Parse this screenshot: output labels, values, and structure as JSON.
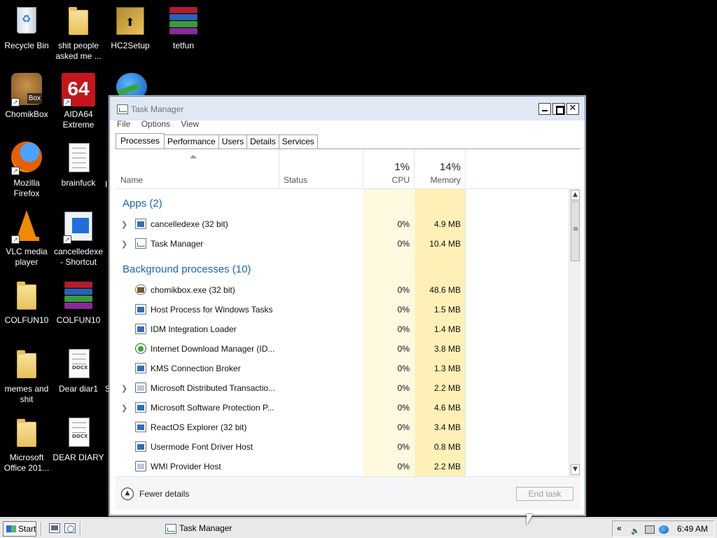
{
  "desktop": {
    "icons": [
      {
        "label": "Recycle Bin",
        "icon": "recycle-bin-icon"
      },
      {
        "label": "shit people asked me ...",
        "icon": "folder-icon"
      },
      {
        "label": "HC2Setup",
        "icon": "installer-icon"
      },
      {
        "label": "tetfun",
        "icon": "winrar-icon"
      },
      {
        "label": "ChomikBox",
        "icon": "chomikbox-icon"
      },
      {
        "label": "AIDA64 Extreme",
        "icon": "aida64-icon"
      },
      {
        "label": "Mozilla Firefox",
        "icon": "firefox-icon"
      },
      {
        "label": "brainfuck",
        "icon": "text-document-icon"
      },
      {
        "label": "VLC media player",
        "icon": "vlc-icon"
      },
      {
        "label": "cancelledexe - Shortcut",
        "icon": "shortcut-icon"
      },
      {
        "label": "COLFUN10",
        "icon": "folder-icon"
      },
      {
        "label": "COLFUN10",
        "icon": "winrar-icon"
      },
      {
        "label": "memes and shit",
        "icon": "folder-icon"
      },
      {
        "label": "Dear diar1",
        "icon": "docx-icon"
      },
      {
        "label": "Microsoft Office 201...",
        "icon": "folder-icon"
      },
      {
        "label": "DEAR DIARY",
        "icon": "docx-icon"
      }
    ],
    "partial_labels": [
      "I",
      "S"
    ],
    "docx_tag": "DOCX",
    "aida_text": "64",
    "chomik_badge": "Box"
  },
  "task_manager": {
    "title": "Task Manager",
    "window_buttons": {
      "close": "✕"
    },
    "menu": [
      "File",
      "Options",
      "View"
    ],
    "tabs": [
      "Processes",
      "Performance",
      "Users",
      "Details",
      "Services"
    ],
    "active_tab": "Processes",
    "columns": {
      "name": "Name",
      "status": "Status",
      "cpu_pct": "1%",
      "cpu": "CPU",
      "memory_pct": "14%",
      "memory": "Memory"
    },
    "groups": {
      "apps_title": "Apps (2)",
      "background_title": "Background processes (10)"
    },
    "apps": [
      {
        "name": "cancelledexe (32 bit)",
        "cpu": "0%",
        "memory": "4.9 MB",
        "expandable": true,
        "icon": "app-window-icon"
      },
      {
        "name": "Task Manager",
        "cpu": "0%",
        "memory": "10.4 MB",
        "expandable": true,
        "icon": "task-manager-icon"
      }
    ],
    "background": [
      {
        "name": "chomikbox.exe (32 bit)",
        "cpu": "0%",
        "memory": "48.6 MB",
        "expandable": false,
        "icon": "chomikbox-icon"
      },
      {
        "name": "Host Process for Windows Tasks",
        "cpu": "0%",
        "memory": "1.5 MB",
        "expandable": false,
        "icon": "app-window-icon"
      },
      {
        "name": "IDM Integration Loader",
        "cpu": "0%",
        "memory": "1.4 MB",
        "expandable": false,
        "icon": "app-window-icon"
      },
      {
        "name": "Internet Download Manager (ID...",
        "cpu": "0%",
        "memory": "3.8 MB",
        "expandable": false,
        "icon": "idm-globe-icon"
      },
      {
        "name": "KMS Connection Broker",
        "cpu": "0%",
        "memory": "1.3 MB",
        "expandable": false,
        "icon": "app-window-icon"
      },
      {
        "name": "Microsoft Distributed Transactio...",
        "cpu": "0%",
        "memory": "2.2 MB",
        "expandable": true,
        "icon": "service-icon"
      },
      {
        "name": "Microsoft Software Protection P...",
        "cpu": "0%",
        "memory": "4.6 MB",
        "expandable": true,
        "icon": "app-window-icon"
      },
      {
        "name": "ReactOS Explorer (32 bit)",
        "cpu": "0%",
        "memory": "3.4 MB",
        "expandable": false,
        "icon": "app-window-icon"
      },
      {
        "name": "Usermode Font Driver Host",
        "cpu": "0%",
        "memory": "0.8 MB",
        "expandable": false,
        "icon": "app-window-icon"
      },
      {
        "name": "WMI Provider Host",
        "cpu": "0%",
        "memory": "2.2 MB",
        "expandable": false,
        "icon": "service-icon"
      }
    ],
    "footer": {
      "fewer_details": "Fewer details",
      "end_task": "End task"
    }
  },
  "taskbar": {
    "start_label": "Start",
    "task_label": "Task Manager",
    "tray_chevron": "«",
    "clock": "6:49 AM"
  },
  "colors": {
    "group_heading": "#1b62b0",
    "cpu_heat": "#fff9e0",
    "memory_heat": "#fff0b8",
    "titlebar": "#dfe8f3"
  }
}
